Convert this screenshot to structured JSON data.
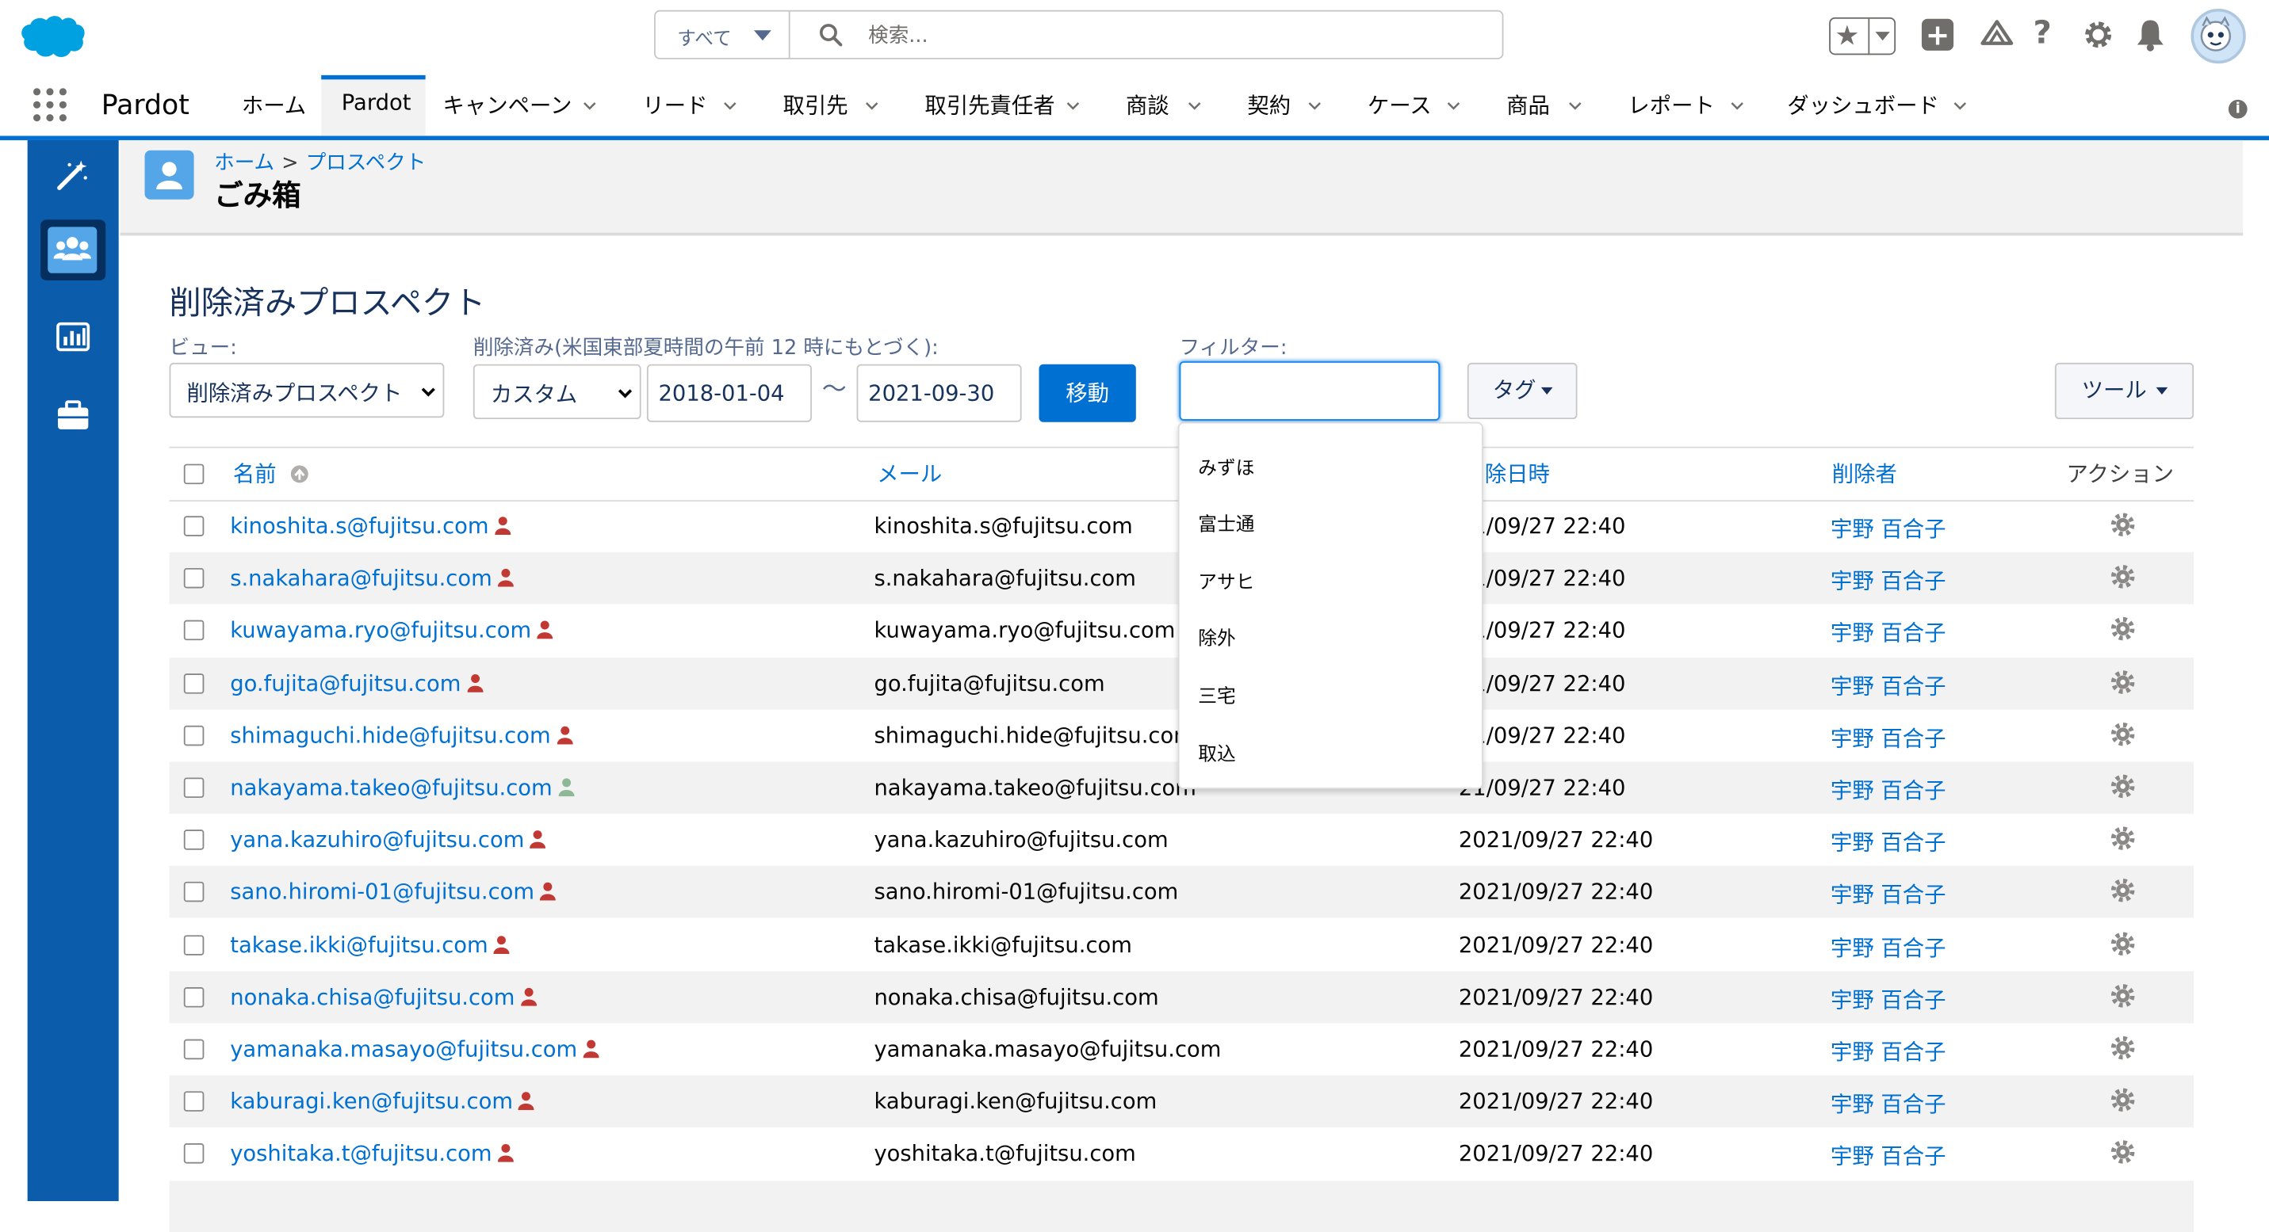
{
  "header": {
    "search_scope": "すべて",
    "search_placeholder": "検索..."
  },
  "nav": {
    "app_name": "Pardot",
    "items": [
      {
        "label": "ホーム",
        "caret": false
      },
      {
        "label": "Pardot",
        "caret": false,
        "active": true
      },
      {
        "label": "キャンペーン",
        "caret": true
      },
      {
        "label": "リード",
        "caret": true
      },
      {
        "label": "取引先",
        "caret": true
      },
      {
        "label": "取引先責任者",
        "caret": true
      },
      {
        "label": "商談",
        "caret": true
      },
      {
        "label": "契約",
        "caret": true
      },
      {
        "label": "ケース",
        "caret": true
      },
      {
        "label": "商品",
        "caret": true
      },
      {
        "label": "レポート",
        "caret": true
      },
      {
        "label": "ダッシュボード",
        "caret": true
      }
    ]
  },
  "page": {
    "breadcrumb_home": "ホーム",
    "breadcrumb_sep": ">",
    "breadcrumb_prospects": "プロスペクト",
    "title": "ごみ箱",
    "section_title": "削除済みプロスペクト"
  },
  "filters": {
    "view_label": "ビュー:",
    "view_value": "削除済みプロスペクト",
    "deleted_label": "削除済み(米国東部夏時間の午前 12 時にもとづく):",
    "range_value": "カスタム",
    "date_from": "2018-01-04",
    "tilde": "〜",
    "date_to": "2021-09-30",
    "move_button": "移動",
    "filter_label": "フィルター:",
    "filter_value": "",
    "tag_button": "タグ",
    "tools_button": "ツール"
  },
  "table": {
    "columns": {
      "name": "名前",
      "email": "メール",
      "deleted_at": "除日時",
      "deleted_by": "削除者",
      "actions": "アクション"
    },
    "rows": [
      {
        "name": "kinoshita.s@fujitsu.com",
        "email": "kinoshita.s@fujitsu.com",
        "deleted_at": "21/09/27 22:40",
        "deleted_by": "宇野 百合子",
        "person_color": "#c23934"
      },
      {
        "name": "s.nakahara@fujitsu.com",
        "email": "s.nakahara@fujitsu.com",
        "deleted_at": "21/09/27 22:40",
        "deleted_by": "宇野 百合子",
        "person_color": "#c23934"
      },
      {
        "name": "kuwayama.ryo@fujitsu.com",
        "email": "kuwayama.ryo@fujitsu.com",
        "deleted_at": "21/09/27 22:40",
        "deleted_by": "宇野 百合子",
        "person_color": "#c23934"
      },
      {
        "name": "go.fujita@fujitsu.com",
        "email": "go.fujita@fujitsu.com",
        "deleted_at": "21/09/27 22:40",
        "deleted_by": "宇野 百合子",
        "person_color": "#c23934"
      },
      {
        "name": "shimaguchi.hide@fujitsu.com",
        "email": "shimaguchi.hide@fujitsu.com",
        "deleted_at": "21/09/27 22:40",
        "deleted_by": "宇野 百合子",
        "person_color": "#c23934"
      },
      {
        "name": "nakayama.takeo@fujitsu.com",
        "email": "nakayama.takeo@fujitsu.com",
        "deleted_at": "21/09/27 22:40",
        "deleted_by": "宇野 百合子",
        "person_color": "#8fb996"
      },
      {
        "name": "yana.kazuhiro@fujitsu.com",
        "email": "yana.kazuhiro@fujitsu.com",
        "deleted_at": "2021/09/27 22:40",
        "deleted_by": "宇野 百合子",
        "person_color": "#c23934"
      },
      {
        "name": "sano.hiromi-01@fujitsu.com",
        "email": "sano.hiromi-01@fujitsu.com",
        "deleted_at": "2021/09/27 22:40",
        "deleted_by": "宇野 百合子",
        "person_color": "#c23934"
      },
      {
        "name": "takase.ikki@fujitsu.com",
        "email": "takase.ikki@fujitsu.com",
        "deleted_at": "2021/09/27 22:40",
        "deleted_by": "宇野 百合子",
        "person_color": "#c23934"
      },
      {
        "name": "nonaka.chisa@fujitsu.com",
        "email": "nonaka.chisa@fujitsu.com",
        "deleted_at": "2021/09/27 22:40",
        "deleted_by": "宇野 百合子",
        "person_color": "#c23934"
      },
      {
        "name": "yamanaka.masayo@fujitsu.com",
        "email": "yamanaka.masayo@fujitsu.com",
        "deleted_at": "2021/09/27 22:40",
        "deleted_by": "宇野 百合子",
        "person_color": "#c23934"
      },
      {
        "name": "kaburagi.ken@fujitsu.com",
        "email": "kaburagi.ken@fujitsu.com",
        "deleted_at": "2021/09/27 22:40",
        "deleted_by": "宇野 百合子",
        "person_color": "#c23934"
      },
      {
        "name": "yoshitaka.t@fujitsu.com",
        "email": "yoshitaka.t@fujitsu.com",
        "deleted_at": "2021/09/27 22:40",
        "deleted_by": "宇野 百合子",
        "person_color": "#c23934"
      }
    ]
  },
  "tag_dropdown": {
    "items": [
      "みずほ",
      "富士通",
      "アサヒ",
      "除外",
      "三宅",
      "取込"
    ]
  },
  "colors": {
    "brand_blue": "#0070d2",
    "sidebar": "#0b5cab",
    "salesforce_cloud": "#00a1e0"
  }
}
